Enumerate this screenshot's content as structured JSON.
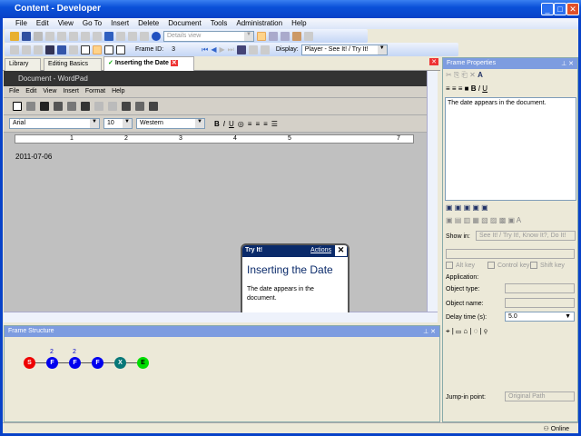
{
  "window": {
    "title": "Content - Developer",
    "min": "_",
    "max": "□",
    "close": "✕"
  },
  "menu": [
    "File",
    "Edit",
    "View",
    "Go To",
    "Insert",
    "Delete",
    "Document",
    "Tools",
    "Administration",
    "Help"
  ],
  "toolbar": {
    "view_select": "Details view",
    "frame_id_label": "Frame ID:",
    "frame_id": "3",
    "display_label": "Display:",
    "display_select": "Player - See It! / Try It!"
  },
  "tabs": [
    {
      "label": "Library"
    },
    {
      "label": "Editing Basics"
    },
    {
      "label": "Inserting the Date",
      "active": true
    }
  ],
  "wordpad": {
    "title": "Document - WordPad",
    "menu": [
      "File",
      "Edit",
      "View",
      "Insert",
      "Format",
      "Help"
    ],
    "font": "Arial",
    "size": "10",
    "script": "Western",
    "ruler": [
      "1",
      "2",
      "3",
      "4",
      "5",
      "7"
    ],
    "content": "2011-07-06"
  },
  "callout": {
    "mode": "Try It!",
    "actions": "Actions",
    "title": "Inserting the Date",
    "text": "The date appears in the document."
  },
  "frame_structure": {
    "title": "Frame Structure",
    "nodes": [
      {
        "l": "S",
        "c": "#ee0000",
        "n": ""
      },
      {
        "l": "F",
        "c": "#0000ee",
        "n": "2"
      },
      {
        "l": "F",
        "c": "#0000ee",
        "n": "2"
      },
      {
        "l": "F",
        "c": "#0000ee",
        "n": ""
      },
      {
        "l": "X",
        "c": "#087878",
        "n": ""
      },
      {
        "l": "E",
        "c": "#00dd00",
        "n": ""
      }
    ]
  },
  "frame_properties": {
    "title": "Frame Properties",
    "text": "The date appears in the document.",
    "show_in_label": "Show in:",
    "show_in": "See It! / Try It!, Know It?, Do It!",
    "alt": "Alt key",
    "ctrl": "Control key",
    "shift": "Shift key",
    "application": "Application:",
    "object_type": "Object type:",
    "object_name": "Object name:",
    "delay_label": "Delay time (s):",
    "delay": "5.0",
    "jump_label": "Jump-in point:",
    "jump": "Original Path"
  },
  "status": {
    "online": "Online"
  }
}
